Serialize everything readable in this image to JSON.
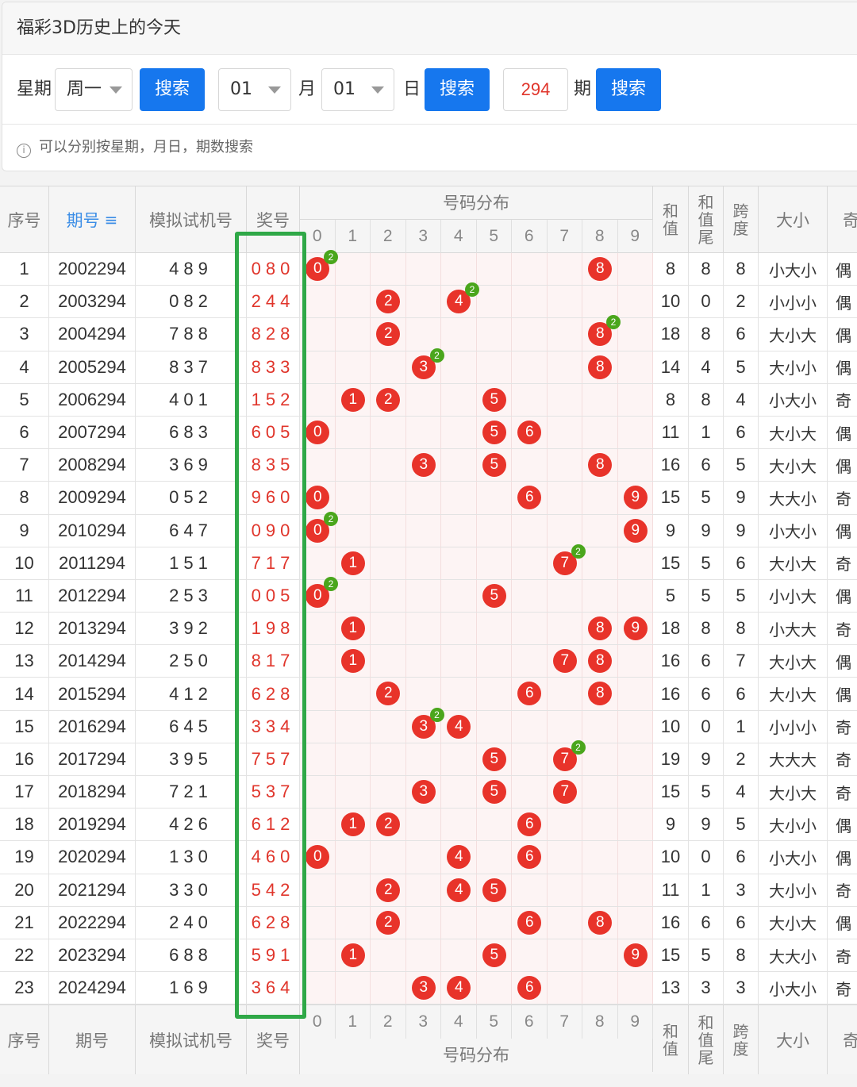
{
  "panel": {
    "title": "福彩3D历史上的今天",
    "weekday_label": "星期",
    "weekday_value": "周一",
    "search_label": "搜索",
    "month_value": "01",
    "month_label": "月",
    "day_value": "01",
    "day_label": "日",
    "period_value": "294",
    "period_label": "期",
    "tip_icon": "i",
    "tip": "可以分别按星期，月日，期数搜索"
  },
  "table": {
    "headers": {
      "index": "序号",
      "period": "期号",
      "period_sort_icon": "≡",
      "sim": "模拟试机号",
      "prize": "奖号",
      "dist": "号码分布",
      "digits": [
        "0",
        "1",
        "2",
        "3",
        "4",
        "5",
        "6",
        "7",
        "8",
        "9"
      ],
      "sum": "和值",
      "sum_tail": "和值尾",
      "span": "跨度",
      "size": "大小",
      "parity": "奇"
    },
    "rows": [
      {
        "idx": "1",
        "period": "2002294",
        "sim": "489",
        "prize": "080",
        "sum": "8",
        "tail": "8",
        "span": "8",
        "size": "小大小",
        "parity": "偶"
      },
      {
        "idx": "2",
        "period": "2003294",
        "sim": "082",
        "prize": "244",
        "sum": "10",
        "tail": "0",
        "span": "2",
        "size": "小小小",
        "parity": "偶"
      },
      {
        "idx": "3",
        "period": "2004294",
        "sim": "788",
        "prize": "828",
        "sum": "18",
        "tail": "8",
        "span": "6",
        "size": "大小大",
        "parity": "偶"
      },
      {
        "idx": "4",
        "period": "2005294",
        "sim": "837",
        "prize": "833",
        "sum": "14",
        "tail": "4",
        "span": "5",
        "size": "大小小",
        "parity": "偶"
      },
      {
        "idx": "5",
        "period": "2006294",
        "sim": "401",
        "prize": "152",
        "sum": "8",
        "tail": "8",
        "span": "4",
        "size": "小大小",
        "parity": "奇"
      },
      {
        "idx": "6",
        "period": "2007294",
        "sim": "683",
        "prize": "605",
        "sum": "11",
        "tail": "1",
        "span": "6",
        "size": "大小大",
        "parity": "偶"
      },
      {
        "idx": "7",
        "period": "2008294",
        "sim": "369",
        "prize": "835",
        "sum": "16",
        "tail": "6",
        "span": "5",
        "size": "大小大",
        "parity": "偶"
      },
      {
        "idx": "8",
        "period": "2009294",
        "sim": "052",
        "prize": "960",
        "sum": "15",
        "tail": "5",
        "span": "9",
        "size": "大大小",
        "parity": "奇"
      },
      {
        "idx": "9",
        "period": "2010294",
        "sim": "647",
        "prize": "090",
        "sum": "9",
        "tail": "9",
        "span": "9",
        "size": "小大小",
        "parity": "偶"
      },
      {
        "idx": "10",
        "period": "2011294",
        "sim": "151",
        "prize": "717",
        "sum": "15",
        "tail": "5",
        "span": "6",
        "size": "大小大",
        "parity": "奇"
      },
      {
        "idx": "11",
        "period": "2012294",
        "sim": "253",
        "prize": "005",
        "sum": "5",
        "tail": "5",
        "span": "5",
        "size": "小小大",
        "parity": "偶"
      },
      {
        "idx": "12",
        "period": "2013294",
        "sim": "392",
        "prize": "198",
        "sum": "18",
        "tail": "8",
        "span": "8",
        "size": "小大大",
        "parity": "奇"
      },
      {
        "idx": "13",
        "period": "2014294",
        "sim": "250",
        "prize": "817",
        "sum": "16",
        "tail": "6",
        "span": "7",
        "size": "大小大",
        "parity": "偶"
      },
      {
        "idx": "14",
        "period": "2015294",
        "sim": "412",
        "prize": "628",
        "sum": "16",
        "tail": "6",
        "span": "6",
        "size": "大小大",
        "parity": "偶"
      },
      {
        "idx": "15",
        "period": "2016294",
        "sim": "645",
        "prize": "334",
        "sum": "10",
        "tail": "0",
        "span": "1",
        "size": "小小小",
        "parity": "奇"
      },
      {
        "idx": "16",
        "period": "2017294",
        "sim": "395",
        "prize": "757",
        "sum": "19",
        "tail": "9",
        "span": "2",
        "size": "大大大",
        "parity": "奇"
      },
      {
        "idx": "17",
        "period": "2018294",
        "sim": "721",
        "prize": "537",
        "sum": "15",
        "tail": "5",
        "span": "4",
        "size": "大小大",
        "parity": "奇"
      },
      {
        "idx": "18",
        "period": "2019294",
        "sim": "426",
        "prize": "612",
        "sum": "9",
        "tail": "9",
        "span": "5",
        "size": "大小小",
        "parity": "偶"
      },
      {
        "idx": "19",
        "period": "2020294",
        "sim": "130",
        "prize": "460",
        "sum": "10",
        "tail": "0",
        "span": "6",
        "size": "小大小",
        "parity": "偶"
      },
      {
        "idx": "20",
        "period": "2021294",
        "sim": "330",
        "prize": "542",
        "sum": "11",
        "tail": "1",
        "span": "3",
        "size": "大小小",
        "parity": "奇"
      },
      {
        "idx": "21",
        "period": "2022294",
        "sim": "240",
        "prize": "628",
        "sum": "16",
        "tail": "6",
        "span": "6",
        "size": "大小大",
        "parity": "偶"
      },
      {
        "idx": "22",
        "period": "2023294",
        "sim": "688",
        "prize": "591",
        "sum": "15",
        "tail": "5",
        "span": "8",
        "size": "大大小",
        "parity": "奇"
      },
      {
        "idx": "23",
        "period": "2024294",
        "sim": "169",
        "prize": "364",
        "sum": "13",
        "tail": "3",
        "span": "3",
        "size": "小大小",
        "parity": "奇"
      }
    ]
  },
  "colors": {
    "accent": "#1677ee",
    "ball": "#e8332a",
    "repeat_badge": "#4aa61c",
    "highlight": "#2fa847",
    "prize_text": "#e0352b"
  }
}
